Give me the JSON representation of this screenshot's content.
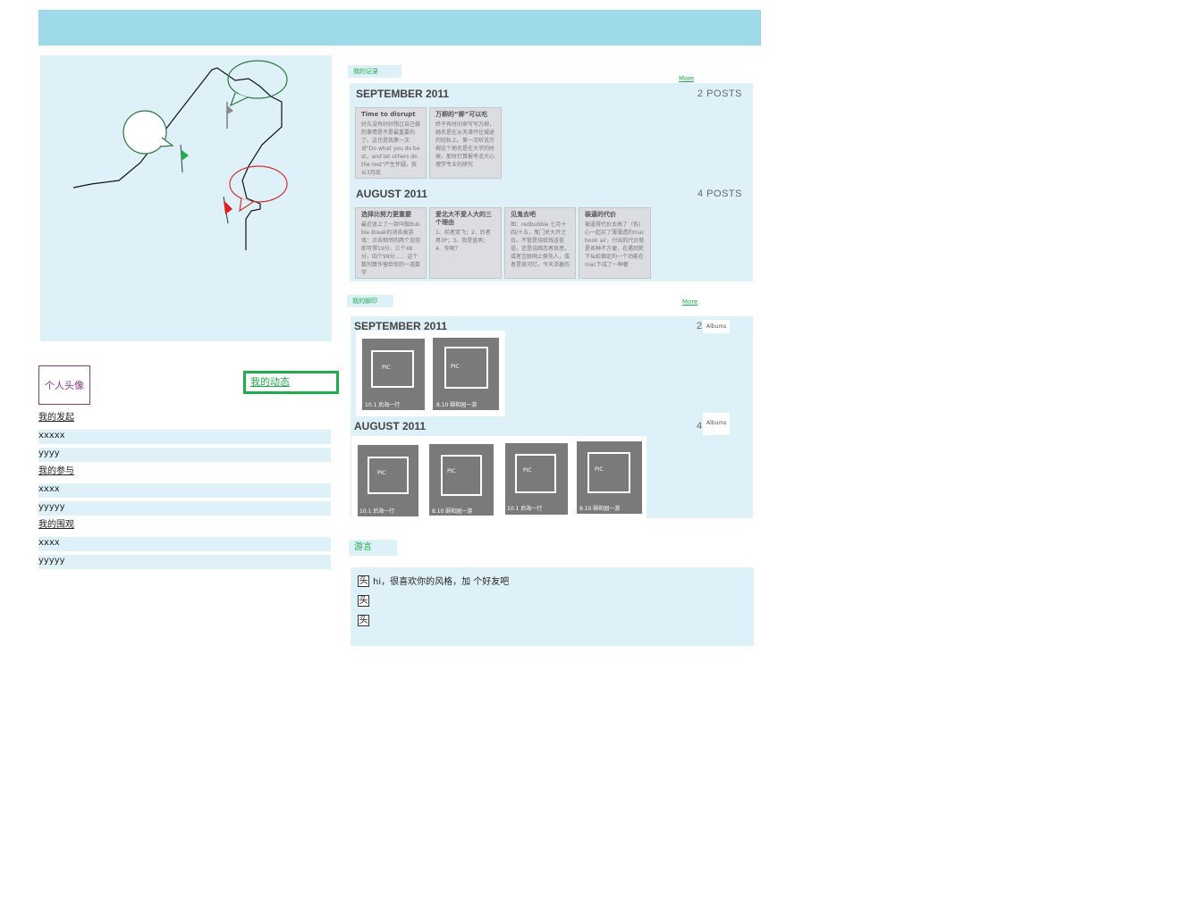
{
  "left": {
    "avatar_label": "个人头像",
    "activity_button": "我的动态",
    "list": [
      {
        "text": "我的发起",
        "type": "head"
      },
      {
        "text": "xxxxx",
        "type": "item"
      },
      {
        "text": "yyyy",
        "type": "item"
      },
      {
        "text": "我的参与",
        "type": "head"
      },
      {
        "text": "xxxx",
        "type": "item"
      },
      {
        "text": "yyyyy",
        "type": "item"
      },
      {
        "text": "我的围观",
        "type": "head"
      },
      {
        "text": "xxxx",
        "type": "item"
      },
      {
        "text": "yyyyy",
        "type": "item"
      }
    ]
  },
  "records": {
    "tag": "我的记录",
    "more": "More",
    "months": [
      {
        "title": "SEPTEMBER 2011",
        "count": "2 POSTS",
        "posts": [
          {
            "title": "Time to disrupt",
            "body": "好久没有好好想过自己做的事情是不是最重要的了。这也是我第一次对\"Do what you do best，and let others do the rest\"产生怀疑。我从3月底"
          },
          {
            "title": "万柳的“柳”可以吃",
            "body": "终于有时间来写写万柳，她名是在从天津开往城途的轻轨上。第一次听说万柳这个地名是在大学的时候，那时打算报考北大心理学专业的研究"
          }
        ]
      },
      {
        "title": "AUGUST 2011",
        "count": "4 POSTS",
        "posts": [
          {
            "title": "选择比努力更重要",
            "body": "最近迷上了一款叫做Bubble Break的消去类游戏：点击相邻的两个泡泡即可得19分，三个48分，四个99分…… 这个数列算作留给你的一道数学"
          },
          {
            "title": "爱北大不爱人大的三个理由",
            "body": "1、前者双飞；2、后者男3P；3、我是直男；4、你呢？"
          },
          {
            "title": "见鬼去吧",
            "body": "图：redbubble 七月十四/十五，鬼门关大开之日。不管是烧纸钱送祖祖，还是烧暗恋者哀思，或者互联网上祭先人，或者是放河灯，今天活着的"
          },
          {
            "title": "装逼的代价",
            "body": "被逼得代价太高了（色)心一起买了薄薄透的macbook air，付出的代价就是各种不方便，在遇到死下坛松捆定的一个功能在mac下成了一种奢"
          }
        ]
      }
    ]
  },
  "footprints": {
    "tag": "我的脚印",
    "more": "More",
    "months": [
      {
        "title": "SEPTEMBER 2011",
        "count": "2",
        "unit": "Albums",
        "albums": [
          {
            "pic": "PIC",
            "caption": "10.1 后海一行"
          },
          {
            "pic": "PIC",
            "caption": "8.10 颐和园一游"
          }
        ]
      },
      {
        "title": "AUGUST 2011",
        "count": "4",
        "unit": "Albums",
        "albums": [
          {
            "pic": "PIC",
            "caption": "10.1 后海一行"
          },
          {
            "pic": "PIC",
            "caption": "8.10 颐和园一游"
          },
          {
            "pic": "PIC",
            "caption": "10.1 后海一行"
          },
          {
            "pic": "PIC",
            "caption": "8.10 颐和园一游"
          }
        ]
      }
    ]
  },
  "guestbook": {
    "tag": "游言",
    "messages": [
      {
        "avatar": "头",
        "text": "hi，很喜欢你的风格，加 个好友吧"
      },
      {
        "avatar": "头",
        "text": ""
      },
      {
        "avatar": "头",
        "text": ""
      }
    ]
  },
  "colors": {
    "accent_green": "#20ac4a",
    "panel_blue": "#dff1f8",
    "bar_blue": "#9fdaea",
    "avatar_purple": "#8a3b8f"
  }
}
